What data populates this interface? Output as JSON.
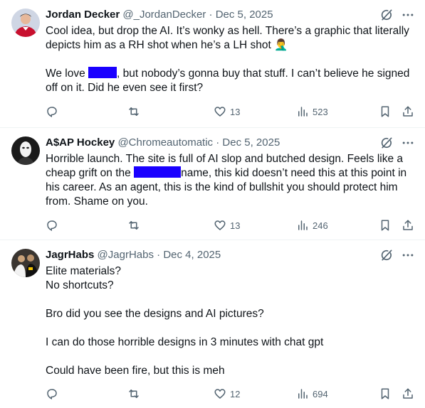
{
  "colors": {
    "text": "#0f1419",
    "muted": "#536471",
    "redaction": "#1a00ff",
    "divider": "#eff3f4"
  },
  "icons": {
    "grok": "grok-icon",
    "more": "more-icon",
    "reply": "reply-icon",
    "repost": "repost-icon",
    "like": "like-icon",
    "views": "views-icon",
    "bookmark": "bookmark-icon",
    "share": "share-icon"
  },
  "tweets": [
    {
      "name": "Jordan Decker",
      "handle": "@_JordanDecker",
      "sep": "·",
      "date": "Dec 5, 2025",
      "lines": [
        "Cool idea, but drop the AI. It’s wonky as hell. There’s a graphic that literally",
        "depicts him as a RH shot when he’s a LH shot 🤦‍♂️",
        "",
        "We love [REDACTED], but nobody’s gonna buy that stuff. I can’t believe he signed",
        "off on it. Did he even see it first?"
      ],
      "text_l3a": "We love ",
      "text_l3b": ", but nobody’s gonna buy that stuff. I can’t believe he signed",
      "likes": "13",
      "views": "523"
    },
    {
      "name": "A$AP Hockey",
      "handle": "@Chromeautomatic",
      "sep": "·",
      "date": "Dec 5, 2025",
      "text_l0": "Horrible launch. The site is full of AI slop and butched design. Feels like a",
      "text_l1a": "cheap grift on the ",
      "text_l1b": "name, this kid doesn’t need this at this point in",
      "text_l2": "his career. As an agent, this is the kind of bullshit you should protect him",
      "text_l3": "from. Shame on you.",
      "likes": "13",
      "views": "246"
    },
    {
      "name": "JagrHabs",
      "handle": "@JagrHabs",
      "sep": "·",
      "date": "Dec 4, 2025",
      "lines": [
        "Elite materials?",
        "No shortcuts?",
        "",
        "Bro did you see the designs and AI pictures?",
        "",
        "I can do those horrible designs in 3 minutes with chat gpt",
        "",
        "Could have been fire, but this is meh"
      ],
      "likes": "12",
      "views": "694"
    }
  ]
}
